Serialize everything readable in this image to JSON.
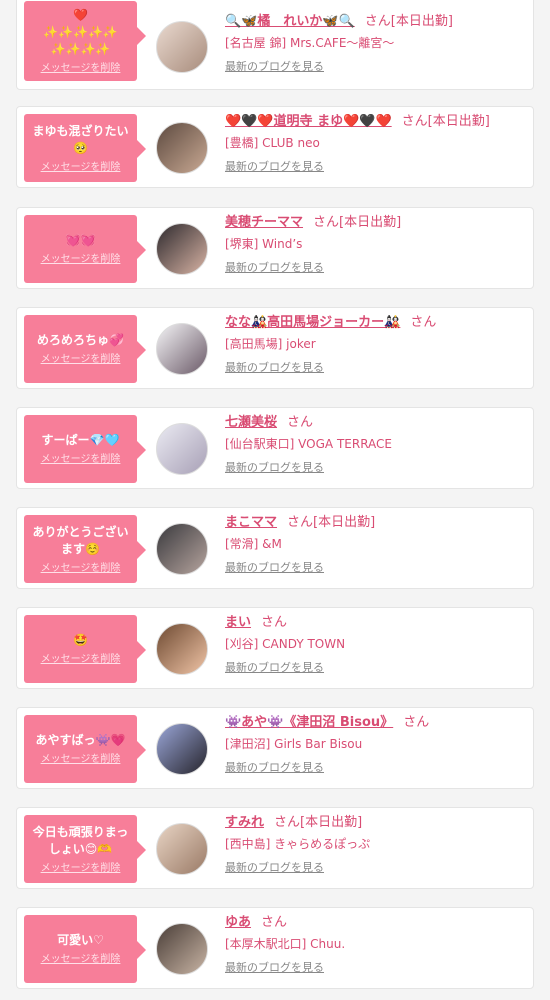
{
  "delete_label": "メッセージを削除",
  "blog_label": "最新のブログを見る",
  "honorific": "さん",
  "cards": [
    {
      "message": "❤️\n✨✨✨✨✨\n✨✨✨✨",
      "name": "🔍🦋橘　れいか🦋🔍",
      "status": "[本日出勤]",
      "shop": "[名古屋 錦] Mrs.CAFE〜離宮〜",
      "avatar_bg": "linear-gradient(135deg,#e9d9cf,#a88c7c)"
    },
    {
      "message": "まゆも混ざりたい🥺",
      "name": "❤️🖤❤️道明寺 まゆ❤️🖤❤️",
      "status": "[本日出勤]",
      "shop": "[豊橋] CLUB neo",
      "avatar_bg": "linear-gradient(135deg,#5d4a40,#c9a993)"
    },
    {
      "message": "💓💓",
      "name": "美穂チーママ",
      "status": "[本日出勤]",
      "shop": "[堺東] Wind’s",
      "avatar_bg": "linear-gradient(135deg,#2e2a2e,#d8b3a4)"
    },
    {
      "message": "めろめろちゅ💞",
      "name": "なな🎎高田馬場ジョーカー🎎",
      "status": "",
      "shop": "[高田馬場] joker",
      "avatar_bg": "linear-gradient(135deg,#f4f4f6,#6b5a68)"
    },
    {
      "message": "すーぱー💎🩵",
      "name": "七瀬美桜",
      "status": "",
      "shop": "[仙台駅東口] VOGA TERRACE",
      "avatar_bg": "linear-gradient(135deg,#eaeaf2,#a8a0b6)"
    },
    {
      "message": "ありがとうございます☺️",
      "name": "まこママ",
      "status": "[本日出勤]",
      "shop": "[常滑] &M",
      "avatar_bg": "linear-gradient(135deg,#3a3a3e,#b6a49e)"
    },
    {
      "message": "🤩",
      "name": "まい",
      "status": "",
      "shop": "[刈谷] CANDY TOWN",
      "avatar_bg": "linear-gradient(135deg,#6e4a32,#f0c4a6)"
    },
    {
      "message": "あやすばっ👾💗",
      "name": "👾あや👾《津田沼 Bisou》",
      "status": "",
      "shop": "[津田沼] Girls Bar Bisou",
      "avatar_bg": "linear-gradient(135deg,#9aa6d8,#26242c)"
    },
    {
      "message": "今日も頑張りまっしょい😊🫶",
      "name": "すみれ",
      "status": "[本日出勤]",
      "shop": "[西中島] きゃらめるぽっぷ",
      "avatar_bg": "linear-gradient(135deg,#e8d4c4,#9a7a66)"
    },
    {
      "message": "可愛い♡",
      "name": "ゆあ",
      "status": "",
      "shop": "[本厚木駅北口] Chuu.",
      "avatar_bg": "linear-gradient(135deg,#4a3e38,#c8b4a4)"
    }
  ]
}
